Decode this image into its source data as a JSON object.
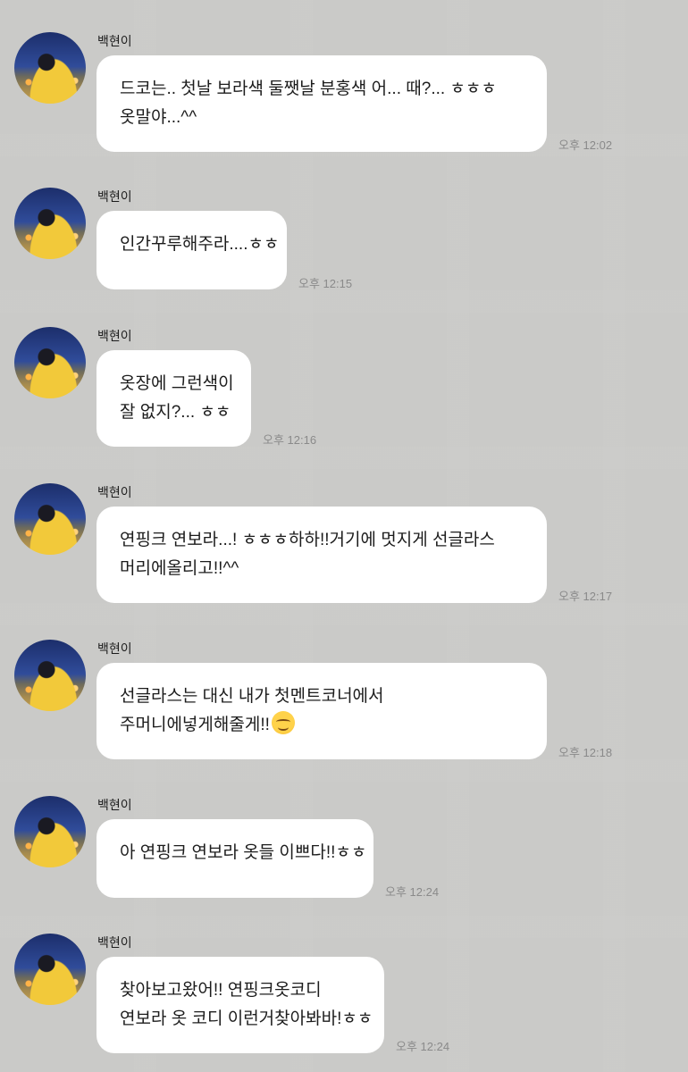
{
  "messages": [
    {
      "sender": "백현이",
      "lines": [
        "드코는.. 첫날 보라색 둘쨋날 분홍색 어... 때?... ㅎㅎㅎ",
        "옷말야...^^"
      ],
      "time": "오후 12:02"
    },
    {
      "sender": "백현이",
      "lines": [
        "인간꾸루해주라....ㅎㅎ"
      ],
      "time": "오후 12:15"
    },
    {
      "sender": "백현이",
      "lines": [
        "옷장에 그런색이",
        "잘 없지?... ㅎㅎ"
      ],
      "time": "오후 12:16"
    },
    {
      "sender": "백현이",
      "lines": [
        "연핑크 연보라...! ㅎㅎㅎ하하!!거기에 멋지게 선글라스",
        "머리에올리고!!^^"
      ],
      "time": "오후 12:17"
    },
    {
      "sender": "백현이",
      "lines": [
        "선글라스는 대신 내가 첫멘트코너에서",
        "주머니에넣게해줄게!!"
      ],
      "emoji": "smiling-face-icon",
      "time": "오후 12:18"
    },
    {
      "sender": "백현이",
      "lines": [
        "아 연핑크 연보라 옷들 이쁘다!!ㅎㅎ"
      ],
      "time": "오후 12:24"
    },
    {
      "sender": "백현이",
      "lines": [
        "찾아보고왔어!! 연핑크옷코디",
        "연보라 옷 코디 이런거찾아봐바!ㅎㅎ"
      ],
      "time": "오후 12:24"
    }
  ]
}
